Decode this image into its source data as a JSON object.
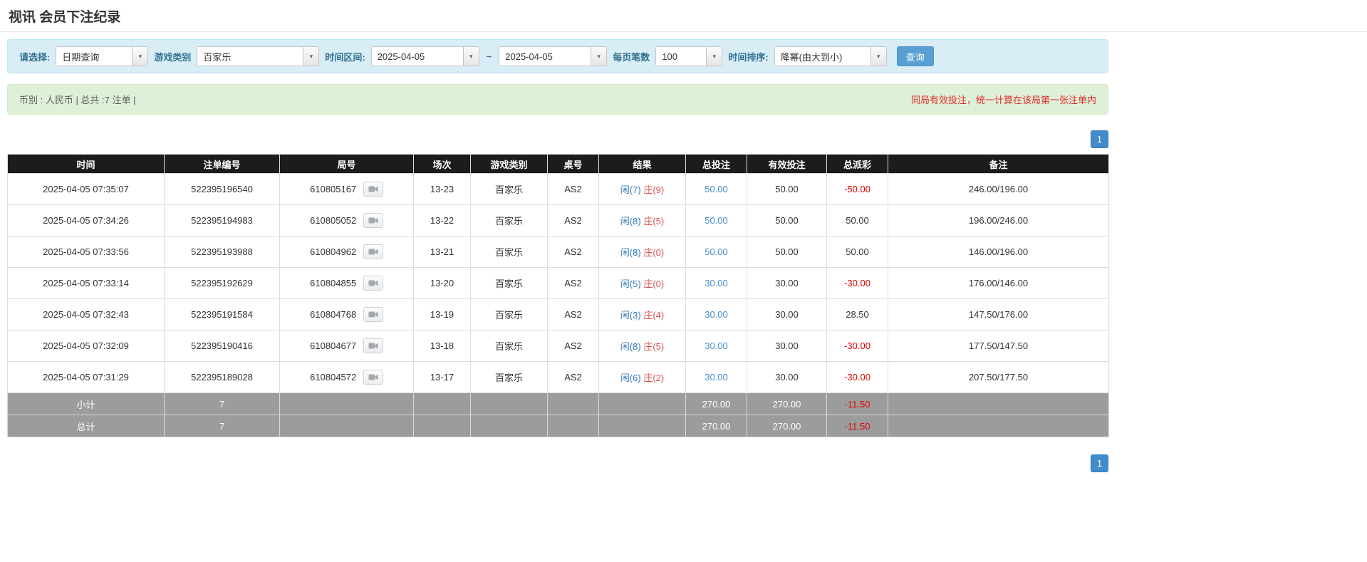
{
  "page": {
    "title": "视讯 会员下注纪录"
  },
  "filters": {
    "select_label": "请选择:",
    "select_value": "日期查询",
    "game_type_label": "游戏类别",
    "game_type_value": "百家乐",
    "date_range_label": "时间区间:",
    "date_from": "2025-04-05",
    "tilde": "~",
    "date_to": "2025-04-05",
    "page_size_label": "每页笔数",
    "page_size_value": "100",
    "sort_label": "时间排序:",
    "sort_value": "降幂(由大到小)",
    "search_button": "查询"
  },
  "summary": {
    "left": "币别 : 人民币 | 总共 :7 注单 |",
    "right": "同局有效投注，统一计算在该局第一张注单内"
  },
  "pagination": {
    "page": "1"
  },
  "table": {
    "headers": [
      "时间",
      "注单编号",
      "局号",
      "场次",
      "游戏类别",
      "桌号",
      "结果",
      "总投注",
      "有效投注",
      "总派彩",
      "备注"
    ],
    "rows": [
      {
        "time": "2025-04-05 07:35:07",
        "bet_id": "522395196540",
        "round_id": "610805167",
        "session": "13-23",
        "game": "百家乐",
        "table_no": "AS2",
        "result_player": "闲(7)",
        "result_banker": "庄(9)",
        "total_bet": "50.00",
        "valid_bet": "50.00",
        "payout": "-50.00",
        "remark": "246.00/196.00"
      },
      {
        "time": "2025-04-05 07:34:26",
        "bet_id": "522395194983",
        "round_id": "610805052",
        "session": "13-22",
        "game": "百家乐",
        "table_no": "AS2",
        "result_player": "闲(8)",
        "result_banker": "庄(5)",
        "total_bet": "50.00",
        "valid_bet": "50.00",
        "payout": "50.00",
        "remark": "196.00/246.00"
      },
      {
        "time": "2025-04-05 07:33:56",
        "bet_id": "522395193988",
        "round_id": "610804962",
        "session": "13-21",
        "game": "百家乐",
        "table_no": "AS2",
        "result_player": "闲(8)",
        "result_banker": "庄(0)",
        "total_bet": "50.00",
        "valid_bet": "50.00",
        "payout": "50.00",
        "remark": "146.00/196.00"
      },
      {
        "time": "2025-04-05 07:33:14",
        "bet_id": "522395192629",
        "round_id": "610804855",
        "session": "13-20",
        "game": "百家乐",
        "table_no": "AS2",
        "result_player": "闲(5)",
        "result_banker": "庄(0)",
        "total_bet": "30.00",
        "valid_bet": "30.00",
        "payout": "-30.00",
        "remark": "176.00/146.00"
      },
      {
        "time": "2025-04-05 07:32:43",
        "bet_id": "522395191584",
        "round_id": "610804768",
        "session": "13-19",
        "game": "百家乐",
        "table_no": "AS2",
        "result_player": "闲(3)",
        "result_banker": "庄(4)",
        "total_bet": "30.00",
        "valid_bet": "30.00",
        "payout": "28.50",
        "remark": "147.50/176.00"
      },
      {
        "time": "2025-04-05 07:32:09",
        "bet_id": "522395190416",
        "round_id": "610804677",
        "session": "13-18",
        "game": "百家乐",
        "table_no": "AS2",
        "result_player": "闲(8)",
        "result_banker": "庄(5)",
        "total_bet": "30.00",
        "valid_bet": "30.00",
        "payout": "-30.00",
        "remark": "177.50/147.50"
      },
      {
        "time": "2025-04-05 07:31:29",
        "bet_id": "522395189028",
        "round_id": "610804572",
        "session": "13-17",
        "game": "百家乐",
        "table_no": "AS2",
        "result_player": "闲(6)",
        "result_banker": "庄(2)",
        "total_bet": "30.00",
        "valid_bet": "30.00",
        "payout": "-30.00",
        "remark": "207.50/177.50"
      }
    ],
    "subtotal": {
      "label": "小计",
      "count": "7",
      "total_bet": "270.00",
      "valid_bet": "270.00",
      "payout": "-11.50"
    },
    "total": {
      "label": "总计",
      "count": "7",
      "total_bet": "270.00",
      "valid_bet": "270.00",
      "payout": "-11.50"
    }
  },
  "icons": {
    "combo_arrow": "▾",
    "replay": "video-replay-icon"
  },
  "colors": {
    "accent_blue": "#428bca",
    "link_blue": "#337ab7",
    "banker_red": "#d9534f",
    "negative_red": "#e60000",
    "filter_bg": "#d9edf7",
    "summary_bg": "#dff0d8",
    "header_bg": "#1c1c1c",
    "footer_row_bg": "#9c9c9c"
  }
}
